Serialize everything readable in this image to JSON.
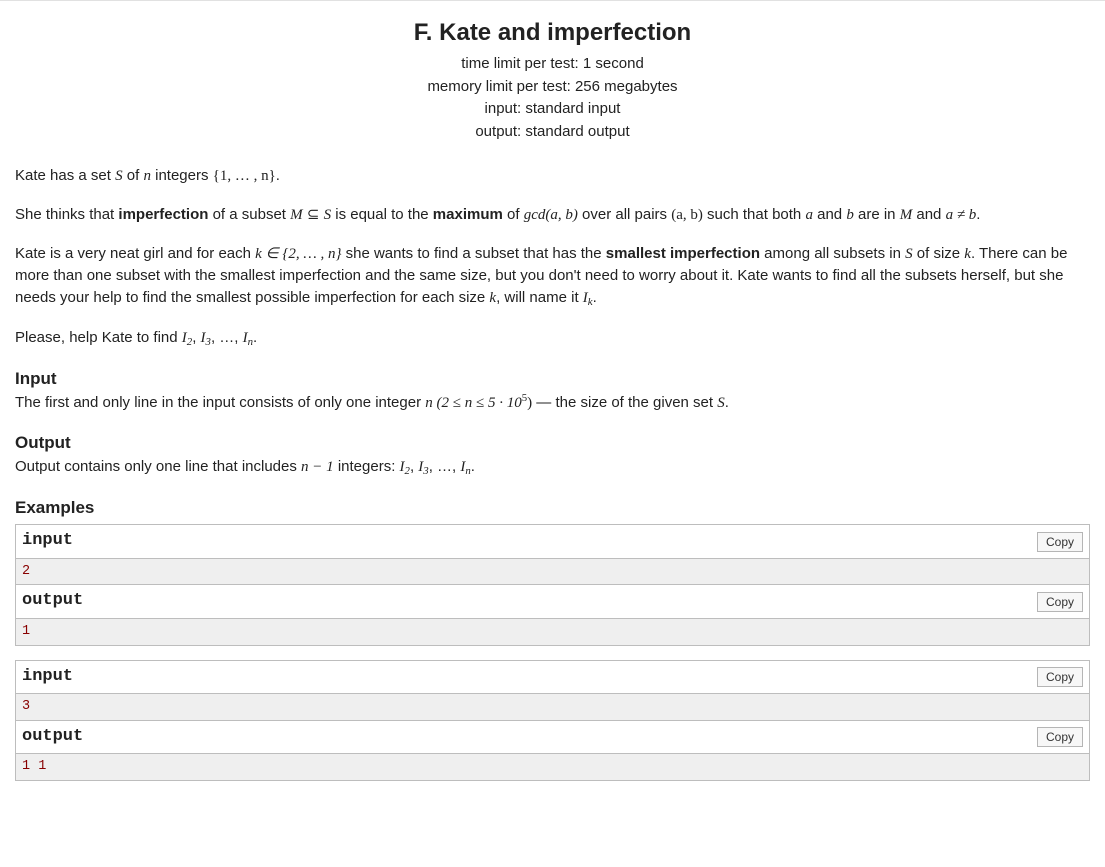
{
  "header": {
    "title": "F. Kate and imperfection",
    "time_limit_label": "time limit per test: ",
    "time_limit_value": "1 second",
    "memory_limit_label": "memory limit per test: ",
    "memory_limit_value": "256 megabytes",
    "input_label": "input: ",
    "input_value": "standard input",
    "output_label": "output: ",
    "output_value": "standard output"
  },
  "statement": {
    "p1_a": "Kate has a set ",
    "p1_b": " of ",
    "p1_c": " integers ",
    "p1_d": ".",
    "p2_a": "She thinks that ",
    "p2_imperfection": "imperfection",
    "p2_b": " of a subset ",
    "p2_c": " is equal to the ",
    "p2_maximum": "maximum",
    "p2_d": " of ",
    "p2_e": " over all pairs ",
    "p2_f": " such that both ",
    "p2_g": " and ",
    "p2_h": " are in ",
    "p2_i": " and ",
    "p2_j": ".",
    "p3_a": "Kate is a very neat girl and for each ",
    "p3_b": " she wants to find a subset that has the ",
    "p3_smallest": "smallest imperfection",
    "p3_c": " among all subsets in ",
    "p3_d": " of size ",
    "p3_e": ". There can be more than one subset with the smallest imperfection and the same size, but you don't need to worry about it. Kate wants to find all the subsets herself, but she needs your help to find the smallest possible imperfection for each size ",
    "p3_f": ", will name it ",
    "p3_g": ".",
    "p4_a": "Please, help Kate to find ",
    "p4_b": "."
  },
  "sections": {
    "input_title": "Input",
    "input_text_a": "The first and only line in the input consists of only one integer ",
    "input_text_b": " — the size of the given set ",
    "input_text_c": ".",
    "output_title": "Output",
    "output_text_a": "Output contains only one line that includes ",
    "output_text_b": " integers: ",
    "output_text_c": ".",
    "examples_title": "Examples"
  },
  "labels": {
    "input": "input",
    "output": "output",
    "copy": "Copy"
  },
  "examples": [
    {
      "input": "2",
      "output": "1"
    },
    {
      "input": "3",
      "output": "1 1"
    }
  ],
  "math": {
    "S": "S",
    "n": "n",
    "set1n": "{1, … , n}",
    "M": "M",
    "subset": "⊆",
    "gcd_ab": "gcd(a, b)",
    "pair_ab": "(a, b)",
    "a": "a",
    "b": "b",
    "aneqb": "a ≠ b",
    "k": "k",
    "kin": "k ∈ {2, … , n}",
    "Ik": "I",
    "I2I3In": "I",
    "n_bounds": "n (2 ≤ n ≤ 5 · 10",
    "five": "5",
    "close": ")",
    "nminus1": "n − 1",
    "two": "2",
    "three": "3",
    "ncap": "n"
  }
}
